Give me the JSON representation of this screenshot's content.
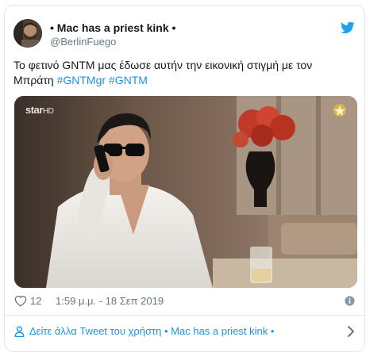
{
  "tweet": {
    "display_name": "• Mac has a priest kink •",
    "handle": "@BerlinFuego",
    "text": "Το φετινό GNTM μας έδωσε αυτήν την εικονική στιγμή με τον Μπράτη",
    "hashtags": [
      "#GNTMgr",
      "#GNTM"
    ],
    "media": {
      "channel_logo": "star",
      "channel_logo_suffix": "HD"
    },
    "likes": "12",
    "timestamp": "1:59 μ.μ. - 18 Σεπ 2019"
  },
  "footer": {
    "more_tweets_label": "Δείτε άλλα Tweet του χρήστη • Mac has a priest kink •"
  },
  "icons": {
    "brand": "twitter-bird-icon",
    "like": "heart-icon",
    "info": "info-icon",
    "person": "person-icon",
    "chevron": "chevron-right-icon"
  },
  "colors": {
    "link": "#1b95e0",
    "secondary_text": "#657786",
    "border": "#e1e8ed",
    "twitter_blue": "#1da1f2"
  }
}
